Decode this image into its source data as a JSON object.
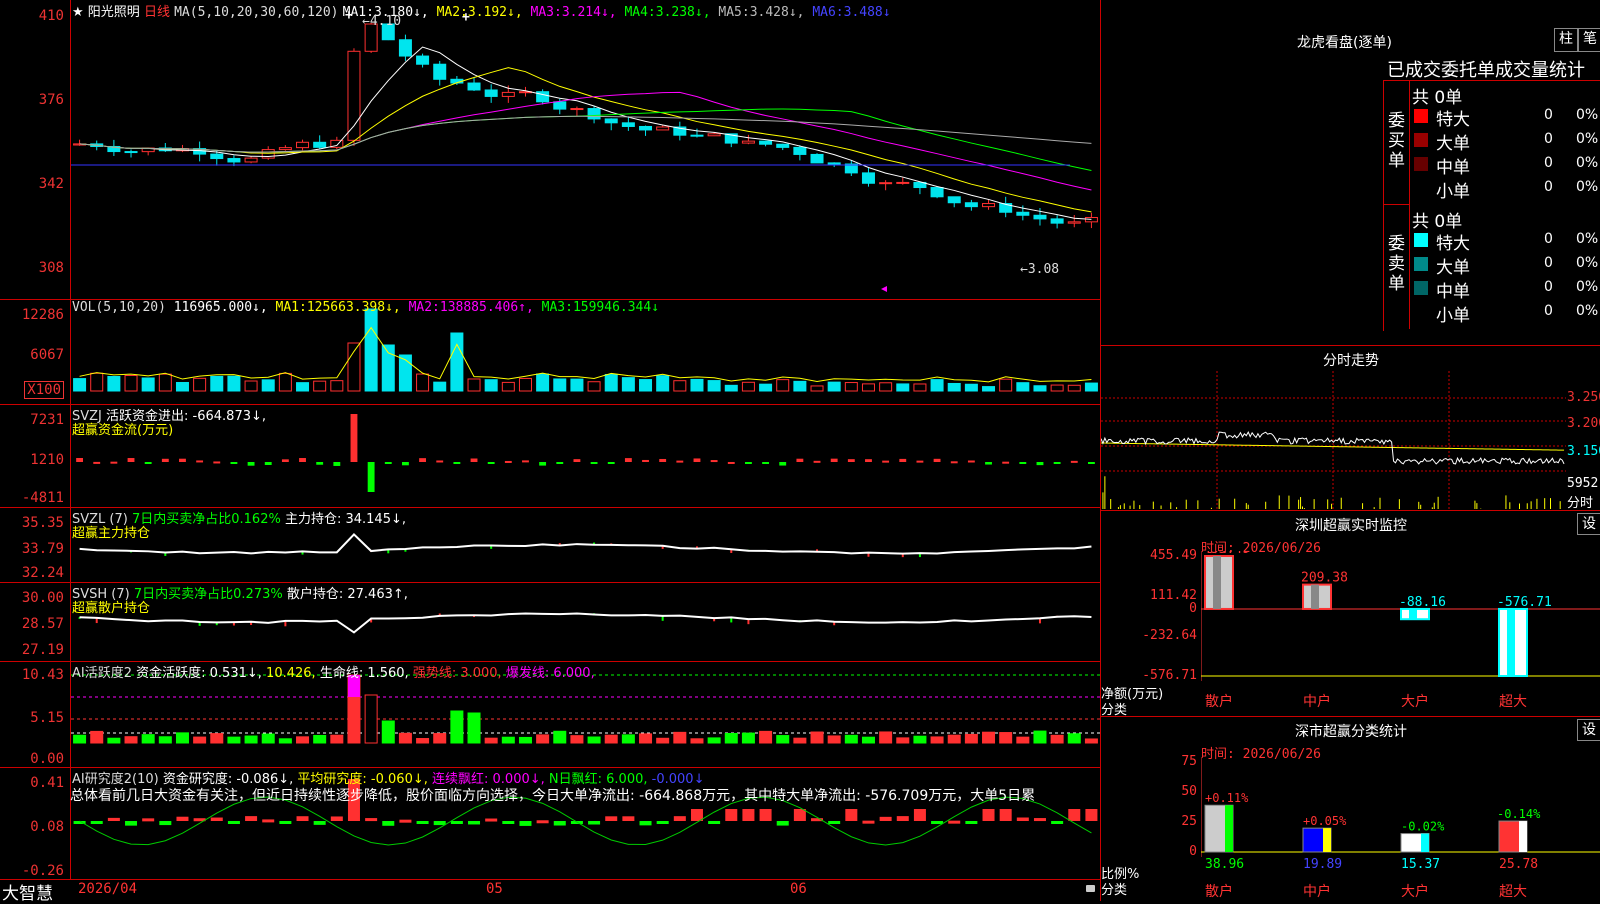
{
  "stock": {
    "name": "阳光照明",
    "period": "日线",
    "star": "★"
  },
  "colors": {
    "up": "#ff3030",
    "down": "#00e5ee",
    "grid": "#cc0000",
    "ma1": "#ffffff",
    "ma2": "#ffff00",
    "ma3": "#ff00ff",
    "ma4": "#00ff00",
    "ma5": "#aaaaaa",
    "ma6": "#3333ff"
  },
  "kline": {
    "ma_label": "MA(5,10,20,30,60,120)",
    "ma": [
      {
        "label": "MA1:",
        "value": "3.180↓,"
      },
      {
        "label": "MA2:",
        "value": "3.192↓,"
      },
      {
        "label": "MA3:",
        "value": "3.214↓,"
      },
      {
        "label": "MA4:",
        "value": "3.238↓,"
      },
      {
        "label": "MA5:",
        "value": "3.428↓,"
      },
      {
        "label": "MA6:",
        "value": "3.488↓"
      }
    ],
    "y_ticks": [
      "410",
      "376",
      "342",
      "308"
    ],
    "high_annotation": "←4.10",
    "low_annotation": "←3.08",
    "buy_marks": [
      "+",
      "+"
    ]
  },
  "vol": {
    "label": "VOL(5,10,20)",
    "value": "116965.000↓,",
    "ma": [
      {
        "label": "MA1:",
        "value": "125663.398↓,"
      },
      {
        "label": "MA2:",
        "value": "138885.406↑,"
      },
      {
        "label": "MA3:",
        "value": "159946.344↓"
      }
    ],
    "y_ticks": [
      "12286",
      "6067"
    ],
    "unit": "X100"
  },
  "svzj": {
    "label": "SVZJ",
    "line1": "活跃资金进出: -664.873↓,",
    "line2": "超赢资金流(万元)",
    "y_ticks": [
      "7231",
      "1210",
      "-4811"
    ]
  },
  "svzl": {
    "label": "SVZL (7)",
    "pct": "7日内买卖净占比0.162%",
    "hold": "主力持仓: 34.145↓,",
    "line2": "超赢主力持仓",
    "y_ticks": [
      "35.35",
      "33.79",
      "32.24"
    ]
  },
  "svsh": {
    "label": "SVSH (7)",
    "pct": "7日内买卖净占比0.273%",
    "hold": "散户持仓: 27.463↑,",
    "line2": "超赢散户持仓",
    "y_ticks": [
      "30.00",
      "28.57",
      "27.19"
    ]
  },
  "ai_active": {
    "label": "AI活跃度2",
    "text1": "资金活跃度: 0.531↓,",
    "text2": "10.426,",
    "text3": "生命线: 1.560,",
    "text4": "强势线: 3.000,",
    "text5": "爆发线: 6.000,",
    "y_ticks": [
      "10.43",
      "5.15",
      "0.00"
    ]
  },
  "ai_research": {
    "label": "AI研究度2(10)",
    "t1": "资金研究度: -0.086↓,",
    "t2": "平均研究度: -0.060↓,",
    "t3": "连续飘红: 0.000↓,",
    "t4": "N日飘红: 6.000,",
    "t5": "-0.000↓",
    "summary": "总体看前几日大资金有关注，但近日持续性逐步降低，股价面临方向选择，今日大单净流出: -664.868万元，其中特大单净流出: -576.709万元，大单5日累",
    "y_ticks": [
      "0.41",
      "0.08",
      "-0.26"
    ]
  },
  "bottom": {
    "brand": "大智慧",
    "dates": [
      "2026/04",
      "05",
      "06"
    ]
  },
  "dragon": {
    "title": "龙虎看盘(逐单)",
    "btn1": "柱",
    "btn2": "笔",
    "header": "已成交委托单成交量统计",
    "buy": {
      "label": "委买单",
      "total": "共 0单",
      "rows": [
        {
          "name": "特大",
          "count": "0",
          "pct": "0%",
          "color": "#ff0000"
        },
        {
          "name": "大单",
          "count": "0",
          "pct": "0%",
          "color": "#990000"
        },
        {
          "name": "中单",
          "count": "0",
          "pct": "0%",
          "color": "#660000"
        },
        {
          "name": "小单",
          "count": "0",
          "pct": "0%",
          "color": "#000000"
        }
      ]
    },
    "sell": {
      "label": "委卖单",
      "total": "共 0单",
      "rows": [
        {
          "name": "特大",
          "count": "0",
          "pct": "0%",
          "color": "#00ffff"
        },
        {
          "name": "大单",
          "count": "0",
          "pct": "0%",
          "color": "#008a8a"
        },
        {
          "name": "中单",
          "count": "0",
          "pct": "0%",
          "color": "#006666"
        },
        {
          "name": "小单",
          "count": "0",
          "pct": "0%",
          "color": "#000000"
        }
      ]
    }
  },
  "intraday": {
    "title": "分时走势",
    "prices": [
      "3.250",
      "3.200",
      "3.150"
    ],
    "vol_label": "5952",
    "unit": "分时"
  },
  "sz_monitor": {
    "title": "深圳超赢实时监控",
    "btn": "设",
    "date": "时间: 2026/06/26",
    "y_ticks": [
      "455.49",
      "111.42",
      "0",
      "-232.64",
      "-576.71"
    ],
    "net_label": "净额(万元)",
    "cat_label": "分类",
    "bars": [
      {
        "name": "散户",
        "value": 455.49,
        "label": "455.49"
      },
      {
        "name": "中户",
        "value": 209.38,
        "label": "209.38"
      },
      {
        "name": "大户",
        "value": -88.16,
        "label": "-88.16"
      },
      {
        "name": "超大",
        "value": -576.71,
        "label": "-576.71"
      }
    ],
    "ymin": -576.71,
    "ymax": 455.49
  },
  "sz_class": {
    "title": "深市超赢分类统计",
    "btn": "设",
    "date": "时间: 2026/06/26",
    "y_ticks": [
      "75",
      "50",
      "25",
      "0"
    ],
    "pct_label": "比例%",
    "cat_label": "分类",
    "bars": [
      {
        "name": "散户",
        "value": 38.96,
        "label": "38.96",
        "change": "+0.11%"
      },
      {
        "name": "中户",
        "value": 19.89,
        "label": "19.89",
        "change": "+0.05%"
      },
      {
        "name": "大户",
        "value": 15.37,
        "label": "15.37",
        "change": "-0.02%"
      },
      {
        "name": "超大",
        "value": 25.78,
        "label": "25.78",
        "change": "-0.14%"
      }
    ],
    "ymax": 75
  }
}
